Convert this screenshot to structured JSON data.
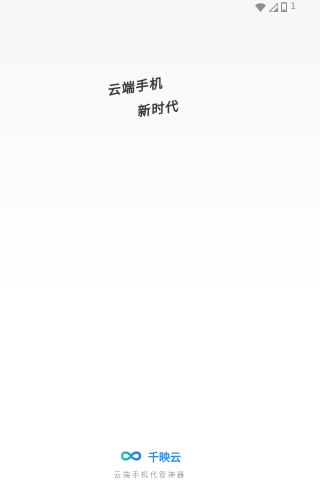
{
  "status_bar": {
    "icons": [
      "wifi-icon",
      "signal-icon",
      "battery-icon"
    ],
    "battery_level": "1",
    "icon_color": "#8e8e8e"
  },
  "slogan": {
    "line1": "云端手机",
    "line2": "新时代",
    "color": "#3a3a3a"
  },
  "footer": {
    "brand_name": "千映云",
    "tagline": "云端手机代管神器",
    "brand_color": "#2f8ee0",
    "logo_icon": "infinity-logo-icon"
  }
}
